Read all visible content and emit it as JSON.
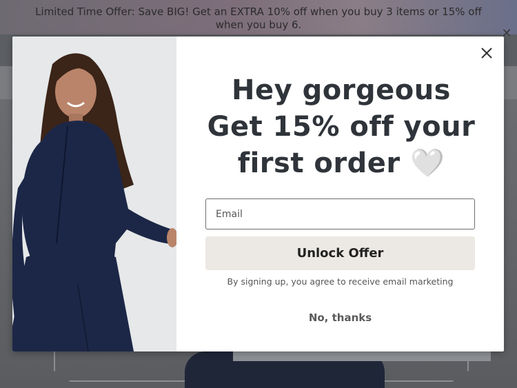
{
  "announcement": {
    "text": "Limited Time Offer: Save BIG! Get an EXTRA 10% off when you buy 3 items or 15% off when you buy 6."
  },
  "modal": {
    "headline_lines": [
      "Hey gorgeous",
      "Get 15% off your",
      "first order 🤍"
    ],
    "email_placeholder": "Email",
    "email_value": "",
    "unlock_label": "Unlock Offer",
    "disclaimer": "By signing up, you agree to receive email marketing",
    "no_thanks_label": "No, thanks"
  },
  "icons": {
    "modal_close": "close-icon",
    "announcement_close": "close-icon"
  },
  "colors": {
    "headline": "#2f343a",
    "button_bg": "#ece8e4",
    "outfit_navy": "#1c2747",
    "overlay": "#5b5e62"
  }
}
